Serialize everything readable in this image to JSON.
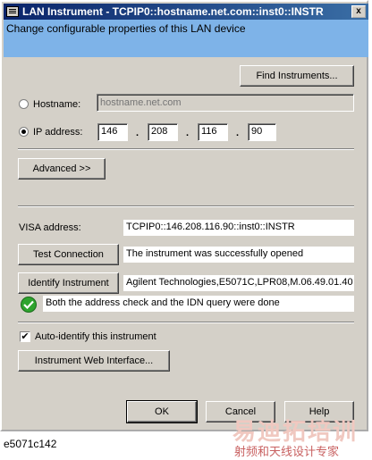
{
  "window": {
    "title": "LAN Instrument - TCPIP0::hostname.net.com::inst0::INSTR",
    "banner": "Change configurable properties of this LAN device",
    "close_glyph": "x"
  },
  "buttons": {
    "find_instruments": "Find Instruments...",
    "advanced": "Advanced >>",
    "test_connection": "Test Connection",
    "identify_instrument": "Identify Instrument",
    "web_interface": "Instrument Web Interface...",
    "ok": "OK",
    "cancel": "Cancel",
    "help": "Help"
  },
  "hostname": {
    "label": "Hostname:",
    "placeholder": "hostname.net.com",
    "selected": false
  },
  "ip": {
    "label": "IP address:",
    "octets": [
      "146",
      "208",
      "116",
      "90"
    ],
    "dot": ".",
    "selected": true
  },
  "visa": {
    "label": "VISA address:",
    "value": "TCPIP0::146.208.116.90::inst0::INSTR"
  },
  "test_result": "The instrument was successfully opened",
  "idn_result": "Agilent Technologies,E5071C,LPR08,M.06.49.01.40",
  "status_message": "Both the address check and the IDN query were done",
  "auto_identify": {
    "label": "Auto-identify this instrument",
    "checked": true,
    "check_glyph": "✔"
  },
  "footer_caption": "e5071c142",
  "watermark": {
    "line1": "易迪拓培训",
    "line2": "射频和天线设计专家"
  }
}
